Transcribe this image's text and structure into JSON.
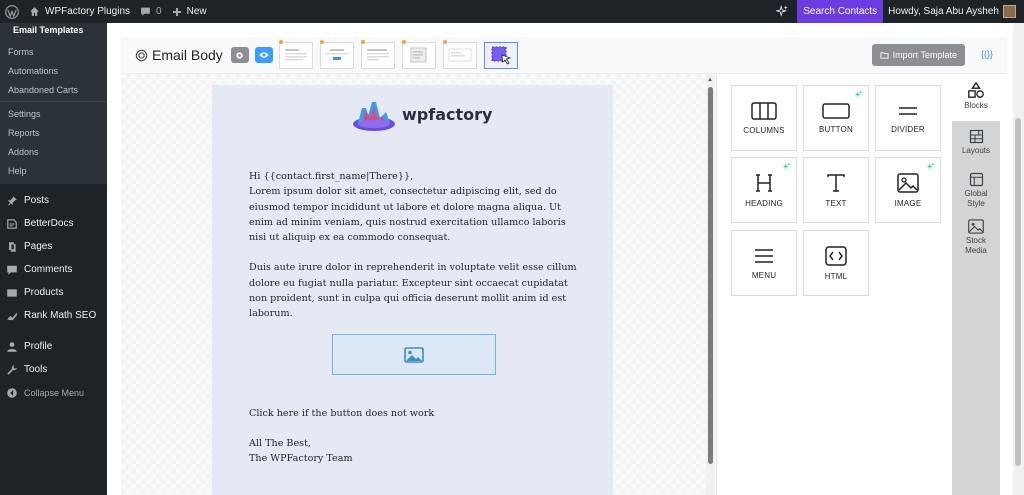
{
  "adminbar": {
    "site_name": "WPFactory Plugins",
    "comments_count": "0",
    "new_label": "New",
    "search_contacts": "Search Contacts",
    "howdy": "Howdy, Saja Abu Aysheh"
  },
  "sidebar": {
    "submenu_title": "Email Templates",
    "sub_items": [
      "Forms",
      "Automations",
      "Abandoned Carts",
      "Settings",
      "Reports",
      "Addons",
      "Help"
    ],
    "items": [
      {
        "label": "Posts",
        "icon": "pin-icon"
      },
      {
        "label": "BetterDocs",
        "icon": "docs-icon"
      },
      {
        "label": "Pages",
        "icon": "pages-icon"
      },
      {
        "label": "Comments",
        "icon": "comment-icon"
      },
      {
        "label": "Products",
        "icon": "products-icon"
      },
      {
        "label": "Rank Math SEO",
        "icon": "rankmath-icon"
      },
      {
        "label": "Profile",
        "icon": "user-icon"
      },
      {
        "label": "Tools",
        "icon": "wrench-icon"
      },
      {
        "label": "Collapse Menu",
        "icon": "collapse-icon"
      }
    ]
  },
  "editor": {
    "title": "Email Body",
    "import_button": "Import Template",
    "merge_tags": "{{}}"
  },
  "email": {
    "logo_text": "wpfactory",
    "greeting": "Hi {{contact.first_name|There}},",
    "paragraph1": "Lorem ipsum dolor sit amet, consectetur adipiscing elit, sed do eiusmod tempor incididunt ut labore et dolore magna aliqua. Ut enim ad minim veniam, quis nostrud exercitation ullamco laboris nisi ut aliquip ex ea commodo consequat.",
    "paragraph2": "Duis aute irure dolor in reprehenderit in voluptate velit esse cillum dolore eu fugiat nulla pariatur. Excepteur sint occaecat cupidatat non proident, sunt in culpa qui officia deserunt mollit anim id est laborum.",
    "button_fallback": "Click here if the button does not work",
    "signoff1": "All The Best,",
    "signoff2": "The WPFactory Team"
  },
  "blocks": [
    {
      "label": "COLUMNS",
      "icon": "columns-icon",
      "ai": false
    },
    {
      "label": "BUTTON",
      "icon": "button-icon",
      "ai": true
    },
    {
      "label": "DIVIDER",
      "icon": "divider-icon",
      "ai": false
    },
    {
      "label": "HEADING",
      "icon": "heading-icon",
      "ai": true
    },
    {
      "label": "TEXT",
      "icon": "text-icon",
      "ai": false
    },
    {
      "label": "IMAGE",
      "icon": "image-icon",
      "ai": true
    },
    {
      "label": "MENU",
      "icon": "menu-icon",
      "ai": false
    },
    {
      "label": "HTML",
      "icon": "html-icon",
      "ai": false
    }
  ],
  "rail_tabs": [
    {
      "label": "Blocks",
      "icon": "shapes-icon",
      "active": true
    },
    {
      "label": "Layouts",
      "icon": "layout-icon",
      "active": false
    },
    {
      "label": "Global Style",
      "icon": "style-icon",
      "active": false
    },
    {
      "label": "Stock Media",
      "icon": "media-icon",
      "active": false
    }
  ],
  "colors": {
    "admin_dark": "#1d2327",
    "accent_purple": "#6c3ce1",
    "email_bg": "#e5e9f4",
    "spark_green": "#2ecc9a"
  }
}
